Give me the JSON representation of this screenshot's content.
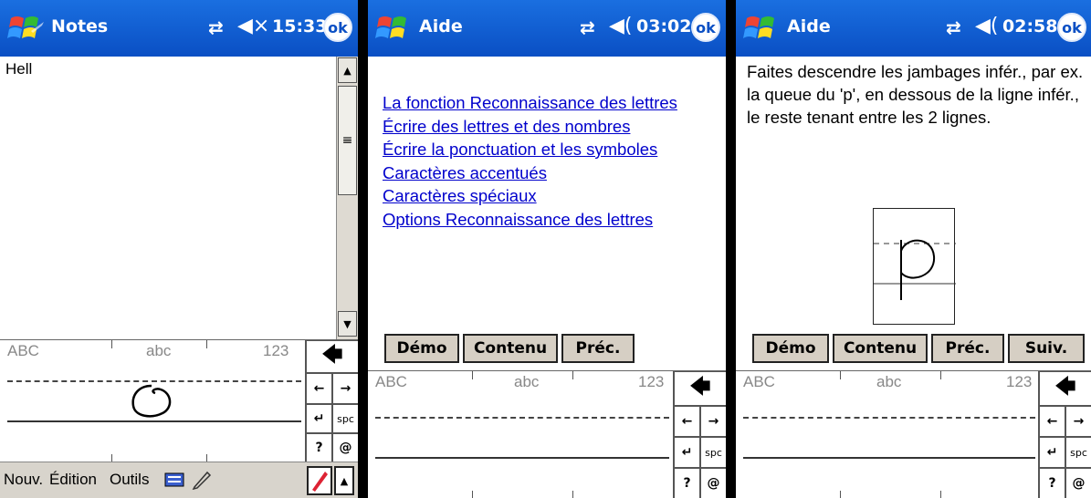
{
  "screens": [
    {
      "title": "Notes",
      "time": "15:33",
      "ok_label": "ok",
      "note_text": "Hell",
      "panel": {
        "mode_upper": "ABC",
        "mode_lower": "abc",
        "mode_num": "123",
        "spc_label": "spc",
        "help_key": "?",
        "symbol_key": "@"
      },
      "menu": {
        "new": "Nouv.",
        "edit": "Édition",
        "tools": "Outils"
      }
    },
    {
      "title": "Aide",
      "time": "03:02",
      "ok_label": "ok",
      "links": [
        "La fonction Reconnaissance des lettres",
        "Écrire des lettres et des nombres",
        "Écrire la ponctuation et les symboles",
        "Caractères accentués",
        "Caractères spéciaux",
        "Options Reconnaissance des lettres"
      ],
      "buttons": {
        "demo": "Démo",
        "contents": "Contenu",
        "prev": "Préc."
      },
      "panel": {
        "mode_upper": "ABC",
        "mode_lower": "abc",
        "mode_num": "123",
        "spc_label": "spc",
        "help_key": "?",
        "symbol_key": "@"
      }
    },
    {
      "title": "Aide",
      "time": "02:58",
      "ok_label": "ok",
      "paragraph": "Faites descendre les jambages infér., par ex. la queue du 'p', en dessous de la ligne infér., le reste tenant entre les 2 lignes.",
      "buttons": {
        "demo": "Démo",
        "contents": "Contenu",
        "prev": "Préc.",
        "next": "Suiv."
      },
      "panel": {
        "mode_upper": "ABC",
        "mode_lower": "abc",
        "mode_num": "123",
        "spc_label": "spc",
        "help_key": "?",
        "symbol_key": "@"
      }
    }
  ],
  "colors": {
    "titlebar": "#0a4fc4",
    "link": "#0000cc",
    "button": "#d6cfc4"
  }
}
